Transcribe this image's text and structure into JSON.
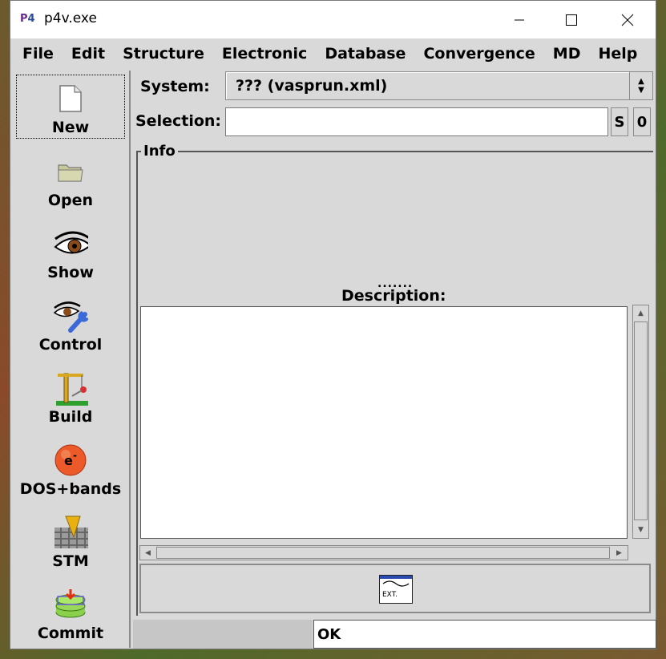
{
  "window": {
    "title": "p4v.exe",
    "icon_text": "P",
    "icon_text_2": "4"
  },
  "menu": [
    "File",
    "Edit",
    "Structure",
    "Electronic",
    "Database",
    "Convergence",
    "MD",
    "Help"
  ],
  "toolbar": {
    "new": "New",
    "open": "Open",
    "show": "Show",
    "control": "Control",
    "build": "Build",
    "dos": "DOS+bands",
    "stm": "STM",
    "commit": "Commit"
  },
  "system": {
    "label": "System:",
    "value": "??? (vasprun.xml)"
  },
  "selection": {
    "label": "Selection:",
    "value": "",
    "btn_s": "S",
    "btn_0": "0"
  },
  "info": {
    "legend": "Info",
    "grip": ".......",
    "description_label": "Description:"
  },
  "ext_button": "EXT.",
  "status": {
    "text": "OK"
  },
  "colors": {
    "window_bg": "#d9d9d9",
    "input_bg": "#ffffff",
    "status_left_bg": "#c6c6c6"
  }
}
